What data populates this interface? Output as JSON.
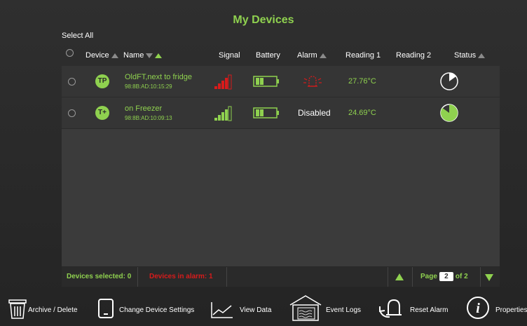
{
  "title": "My Devices",
  "headers": {
    "select_all": "Select All",
    "device": "Device",
    "name": "Name",
    "signal": "Signal",
    "battery": "Battery",
    "alarm": "Alarm",
    "reading1": "Reading 1",
    "reading2": "Reading 2",
    "status": "Status"
  },
  "devices": [
    {
      "badge": "TP",
      "name": "OldFT,next to fridge",
      "mac": "98:8B:AD:10:15:29",
      "signal_color": "#d81b1b",
      "alarm": "",
      "alarm_icon": "alarm-bell-icon",
      "reading1": "27.76°C",
      "reading2": "",
      "status_fill": 0.15
    },
    {
      "badge": "T+",
      "name": "on Freezer",
      "mac": "98:8B:AD:10:09:13",
      "signal_color": "#8fd14f",
      "alarm": "Disabled",
      "alarm_icon": "",
      "reading1": "24.69°C",
      "reading2": "",
      "status_fill": 0.85
    }
  ],
  "footer": {
    "devices_selected": "Devices selected: 0",
    "devices_in_alarm": "Devices in alarm: 1",
    "page_label": "Page",
    "page_current": "2",
    "page_of": "of 2"
  },
  "toolbar": {
    "archive": "Archive / Delete",
    "change_settings": "Change Device Settings",
    "view_data": "View Data",
    "event_logs": "Event Logs",
    "reset_alarm": "Reset Alarm",
    "properties": "Properties"
  },
  "colors": {
    "accent": "#8fd14f",
    "alarm_red": "#d81b1b"
  }
}
